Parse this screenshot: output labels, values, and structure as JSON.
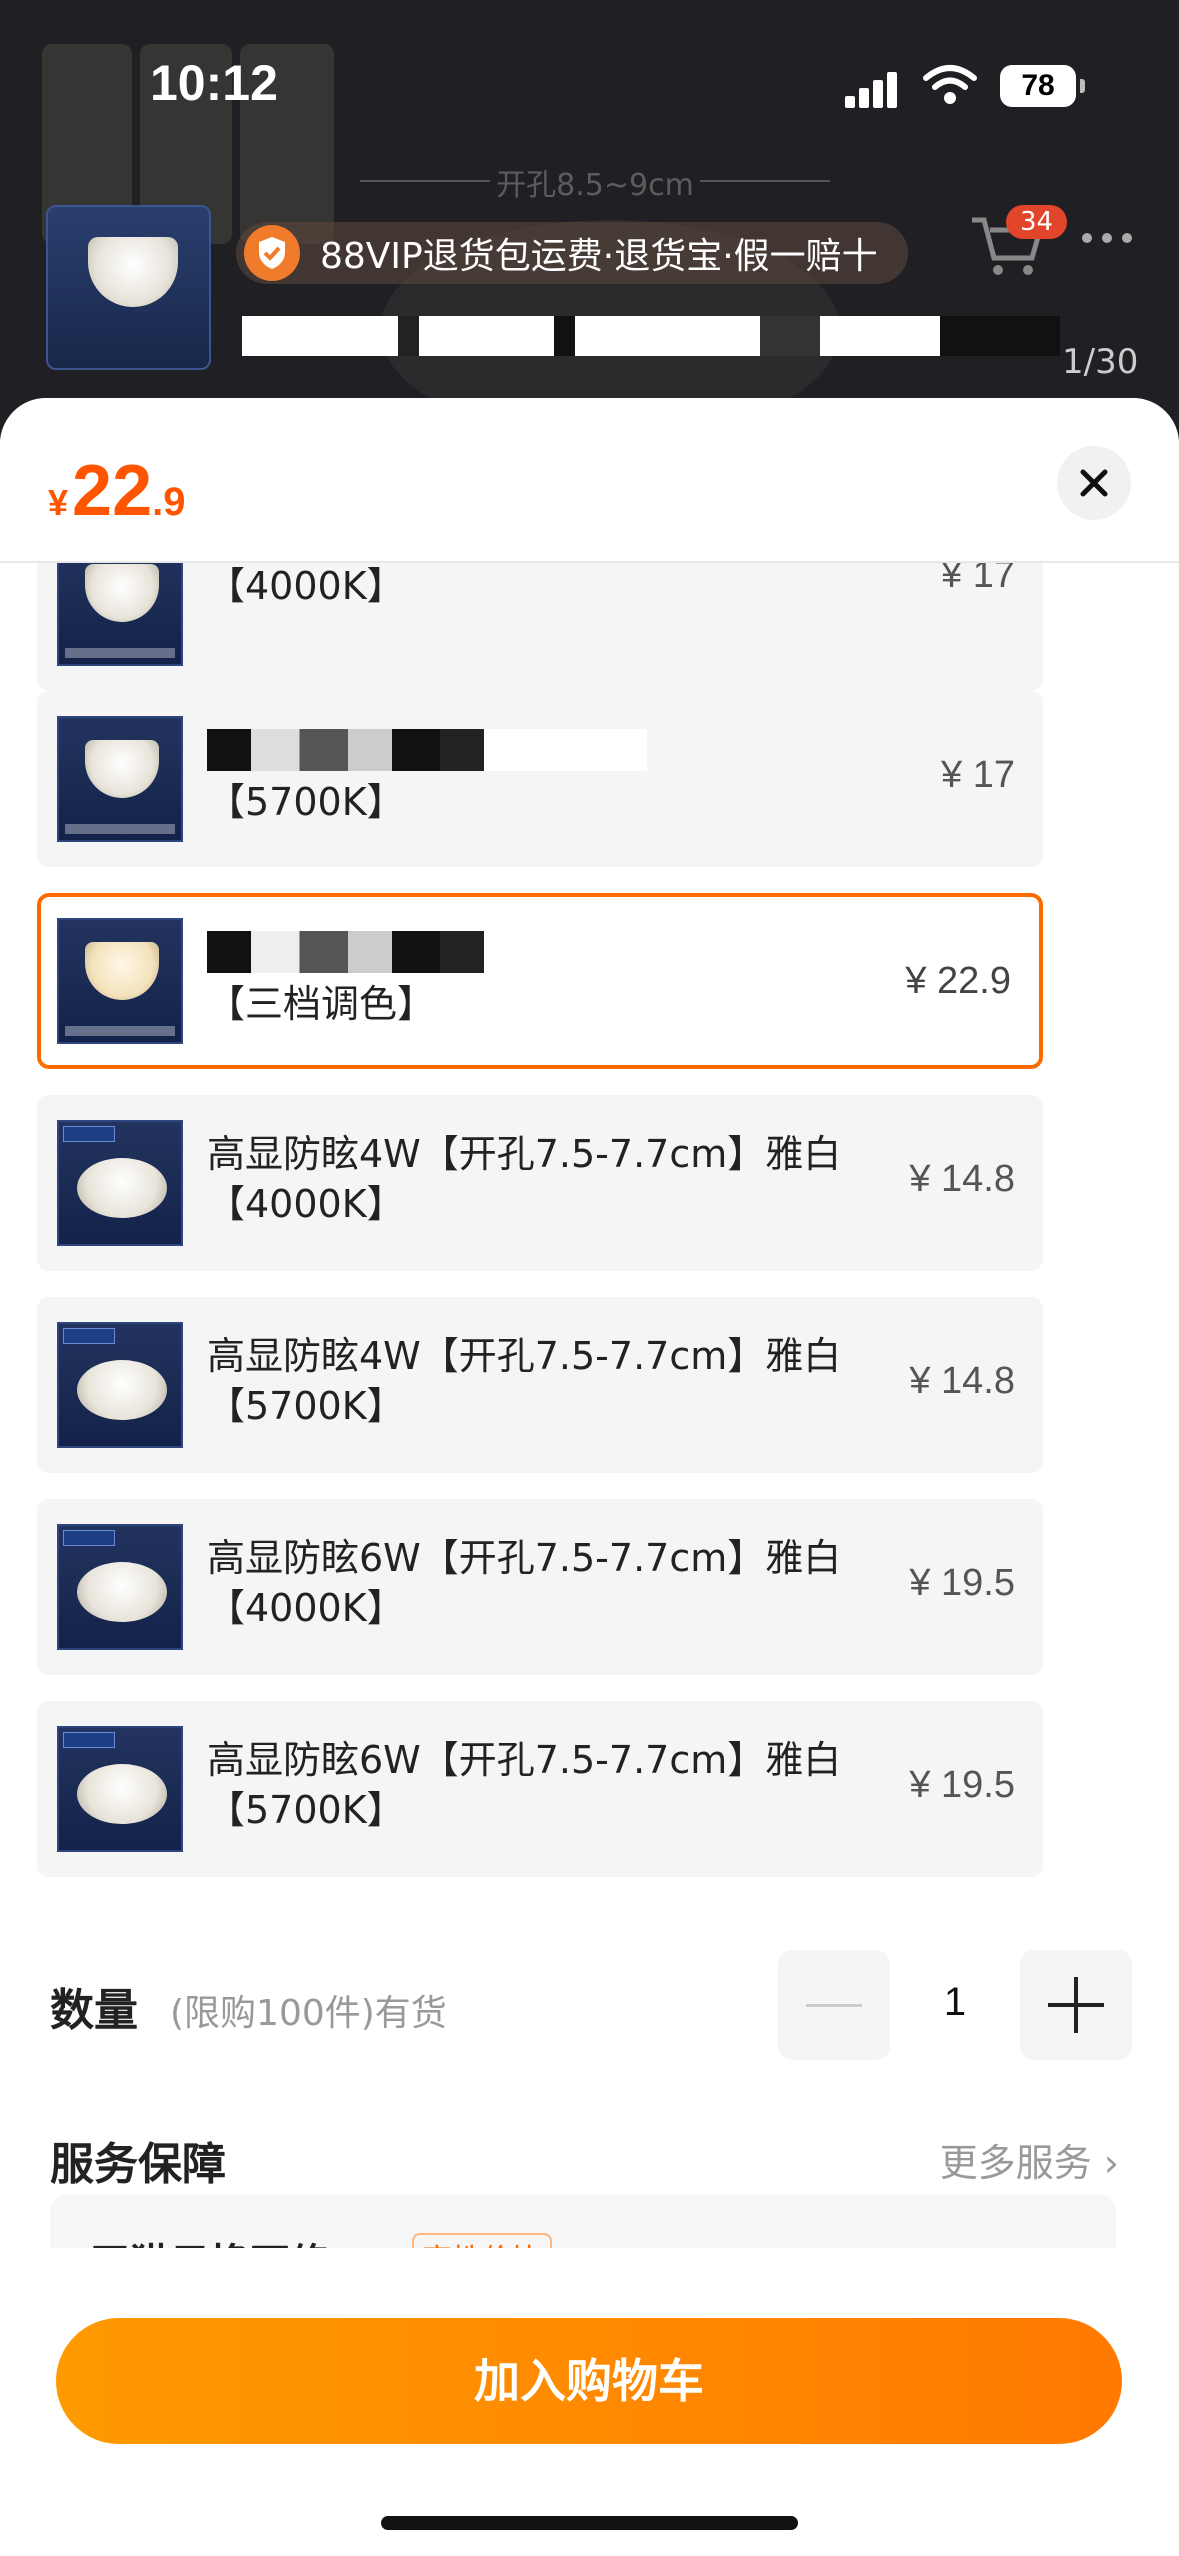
{
  "status_bar": {
    "time": "10:12",
    "battery": "78"
  },
  "background": {
    "dimension_label": "开孔8.5~9cm",
    "vip_banner": "88VIP退货包运费·退货宝·假一赔十",
    "cart_badge": "34",
    "page_indicator": "1/30"
  },
  "sheet": {
    "price": {
      "currency": "¥",
      "integer": "22",
      "decimal": ".9"
    },
    "skus": [
      {
        "name": "【4000K】",
        "price": "¥ 17",
        "selected": false
      },
      {
        "name": "【5700K】",
        "price": "¥ 17",
        "selected": false
      },
      {
        "name": "【三档调色】",
        "price": "¥ 22.9",
        "selected": true
      },
      {
        "name": "高显防眩4W【开孔7.5-7.7cm】雅白【4000K】",
        "price": "¥ 14.8",
        "selected": false
      },
      {
        "name": "高显防眩4W【开孔7.5-7.7cm】雅白【5700K】",
        "price": "¥ 14.8",
        "selected": false
      },
      {
        "name": "高显防眩6W【开孔7.5-7.7cm】雅白【4000K】",
        "price": "¥ 19.5",
        "selected": false
      },
      {
        "name": "高显防眩6W【开孔7.5-7.7cm】雅白【5700K】",
        "price": "¥ 19.5",
        "selected": false
      }
    ],
    "quantity": {
      "label": "数量",
      "note": "(限购100件)有货",
      "value": "1"
    },
    "service": {
      "title": "服务保障",
      "more": "更多服务",
      "card_text": "天猫只换不修",
      "card_badge": "高性价比"
    },
    "add_to_cart": "加入购物车"
  },
  "colors": {
    "accent": "#ff6a00",
    "price": "#ff5500",
    "button": "#ff8a00"
  }
}
